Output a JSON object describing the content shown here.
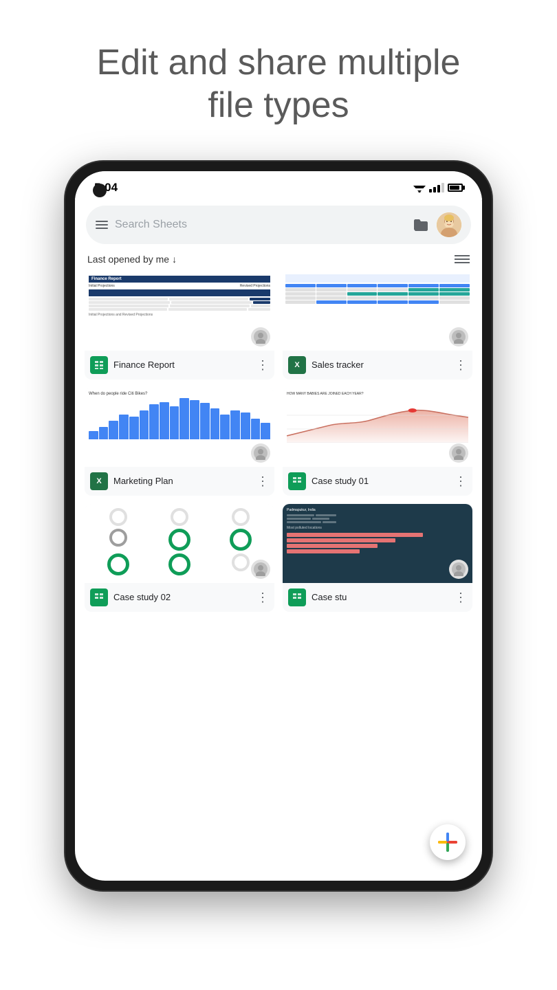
{
  "header": {
    "title_line1": "Edit and share multiple",
    "title_line2": "file types"
  },
  "status_bar": {
    "time": "5:04"
  },
  "search": {
    "placeholder": "Search Sheets"
  },
  "sort": {
    "label": "Last opened by me",
    "arrow": "↓"
  },
  "files": [
    {
      "id": "finance-report",
      "name": "Finance Report",
      "icon_type": "sheets",
      "icon_label": "✦"
    },
    {
      "id": "sales-tracker",
      "name": "Sales tracker",
      "icon_type": "excel",
      "icon_label": "X"
    },
    {
      "id": "marketing-plan",
      "name": "Marketing Plan",
      "icon_type": "excel",
      "icon_label": "X"
    },
    {
      "id": "case-study-01",
      "name": "Case study 01",
      "icon_type": "sheets",
      "icon_label": "✦"
    },
    {
      "id": "case-study-02",
      "name": "Case study 02",
      "icon_type": "sheets",
      "icon_label": "✦"
    },
    {
      "id": "case-study-03",
      "name": "Case stu",
      "icon_type": "sheets",
      "icon_label": "✦"
    }
  ],
  "fab": {
    "label": "+"
  },
  "colors": {
    "sheets_green": "#0f9d58",
    "excel_green": "#217346",
    "accent_blue": "#4285f4",
    "fab_plus_red": "#ea4335",
    "fab_plus_blue": "#4285f4",
    "fab_plus_yellow": "#fbbc04",
    "fab_plus_green": "#34a853"
  }
}
